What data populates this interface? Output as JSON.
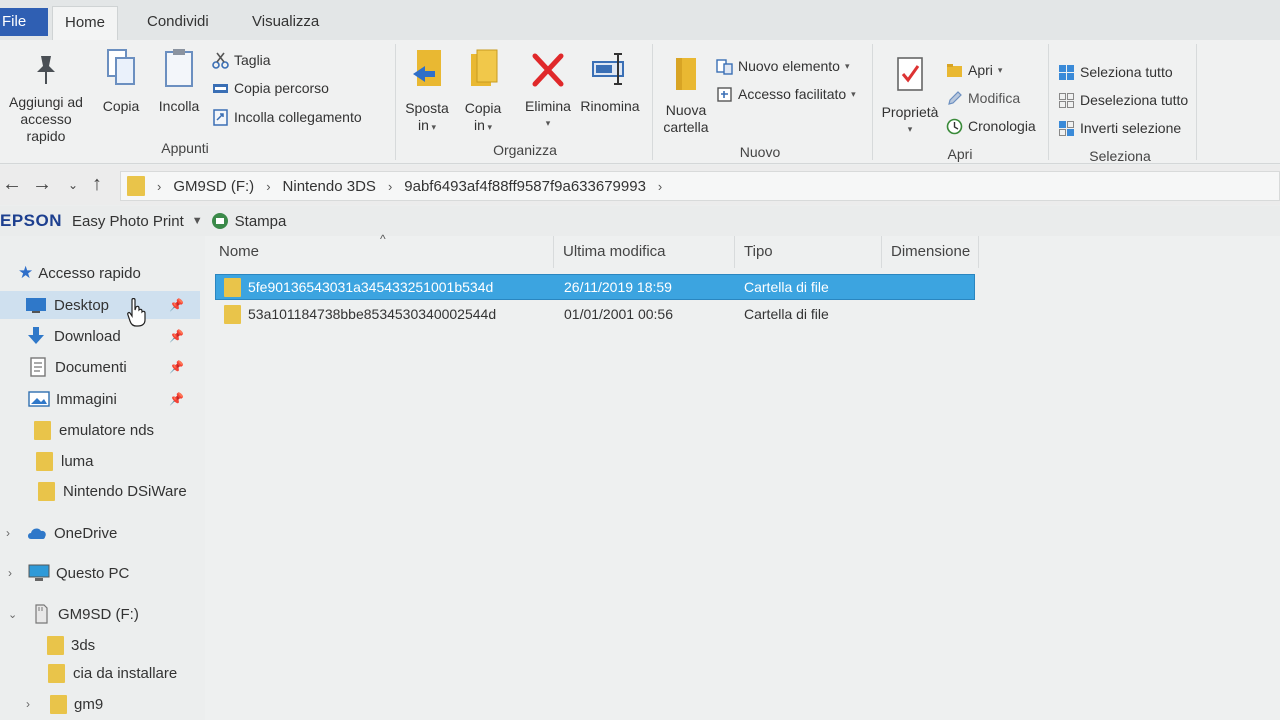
{
  "tabs": {
    "file": "File",
    "home": "Home",
    "share": "Condividi",
    "view": "Visualizza"
  },
  "ribbon": {
    "clipboard": {
      "pin_label_line1": "Aggiungi ad",
      "pin_label_line2": "accesso rapido",
      "copy": "Copia",
      "paste": "Incolla",
      "cut": "Taglia",
      "copy_path": "Copia percorso",
      "paste_shortcut": "Incolla collegamento",
      "group": "Appunti"
    },
    "organize": {
      "move_line1": "Sposta",
      "move_line2": "in",
      "copyto_line1": "Copia",
      "copyto_line2": "in",
      "delete": "Elimina",
      "rename": "Rinomina",
      "group": "Organizza"
    },
    "new": {
      "new_folder_line1": "Nuova",
      "new_folder_line2": "cartella",
      "new_item": "Nuovo elemento",
      "easy_access": "Accesso facilitato",
      "group": "Nuovo"
    },
    "open": {
      "properties": "Proprietà",
      "open": "Apri",
      "edit": "Modifica",
      "history": "Cronologia",
      "group": "Apri"
    },
    "select": {
      "select_all": "Seleziona tutto",
      "select_none": "Deseleziona tutto",
      "invert": "Inverti selezione",
      "group": "Seleziona"
    }
  },
  "address": {
    "crumbs": [
      "GM9SD (F:)",
      "Nintendo 3DS",
      "9abf6493af4f88ff9587f9a633679993"
    ]
  },
  "epson": {
    "brand": "EPSON",
    "app": "Easy Photo Print",
    "print": "Stampa"
  },
  "navpane": {
    "quick_access": "Accesso rapido",
    "items": [
      {
        "label": "Desktop",
        "pinned": true
      },
      {
        "label": "Download",
        "pinned": true
      },
      {
        "label": "Documenti",
        "pinned": true
      },
      {
        "label": "Immagini",
        "pinned": true
      },
      {
        "label": "emulatore nds"
      },
      {
        "label": "luma"
      },
      {
        "label": "Nintendo DSiWare"
      }
    ],
    "onedrive": "OneDrive",
    "this_pc": "Questo PC",
    "drive": "GM9SD (F:)",
    "drive_children": [
      "3ds",
      "cia da installare",
      "gm9"
    ]
  },
  "filelist": {
    "columns": [
      "Nome",
      "Ultima modifica",
      "Tipo",
      "Dimensione"
    ],
    "rows": [
      {
        "name": "5fe90136543031a345433251001b534d",
        "modified": "26/11/2019 18:59",
        "type": "Cartella di file",
        "selected": true
      },
      {
        "name": "53a101184738bbe8534530340002544d",
        "modified": "01/01/2001 00:56",
        "type": "Cartella di file",
        "selected": false
      }
    ]
  },
  "colors": {
    "accent": "#2f5fb3",
    "selection": "#3ca4e0",
    "folder": "#e9c44a"
  }
}
